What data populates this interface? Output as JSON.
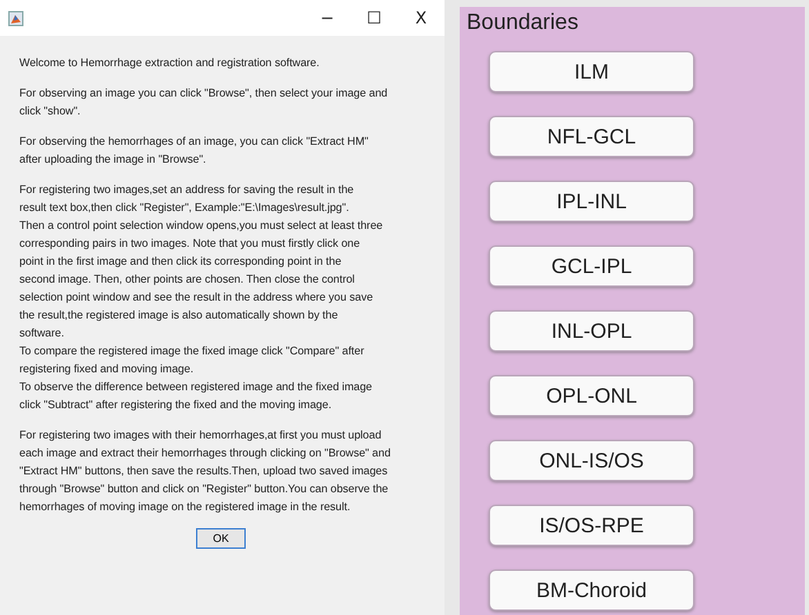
{
  "dialog": {
    "window_controls": [
      "−",
      "☐",
      "X"
    ],
    "paragraphs": [
      "Welcome to Hemorrhage extraction and registration software.",
      "For observing an image you can click \"Browse\", then select your image and\nclick \"show\".",
      "For observing the hemorrhages of an image, you can click \"Extract HM\"\nafter uploading the image in \"Browse\".",
      "For registering two images,set an address for saving the result in the\nresult text box,then click \"Register\", Example:\"E:\\Images\\result.jpg\".\nThen a control point selection window opens,you must select at least three\ncorresponding pairs in two images. Note that you must firstly click one\npoint in the first image and then click its corresponding point in the\nsecond image. Then, other points are chosen. Then close the control\nselection point window and see the result in the address where you save\nthe result,the registered image is also automatically shown by the\nsoftware.\nTo compare the registered image the fixed image click \"Compare\" after\nregistering fixed and moving image.\nTo observe the difference between registered image and the fixed image\nclick \"Subtract\" after registering the fixed and the moving image.",
      "For registering two images with their hemorrhages,at first you must upload\neach image and extract their hemorrhages through clicking on \"Browse\" and\n\"Extract HM\" buttons, then save the results.Then, upload two saved images\nthrough \"Browse\" button and click on \"Register\" button.You can observe the\nhemorrhages of moving image on the registered image in the result."
    ],
    "ok_button": "OK"
  },
  "boundaries": {
    "title": "Boundaries",
    "buttons": [
      "ILM",
      "NFL-GCL",
      "IPL-INL",
      "GCL-IPL",
      "INL-OPL",
      "OPL-ONL",
      "ONL-IS/OS",
      "IS/OS-RPE",
      "BM-Choroid"
    ]
  }
}
